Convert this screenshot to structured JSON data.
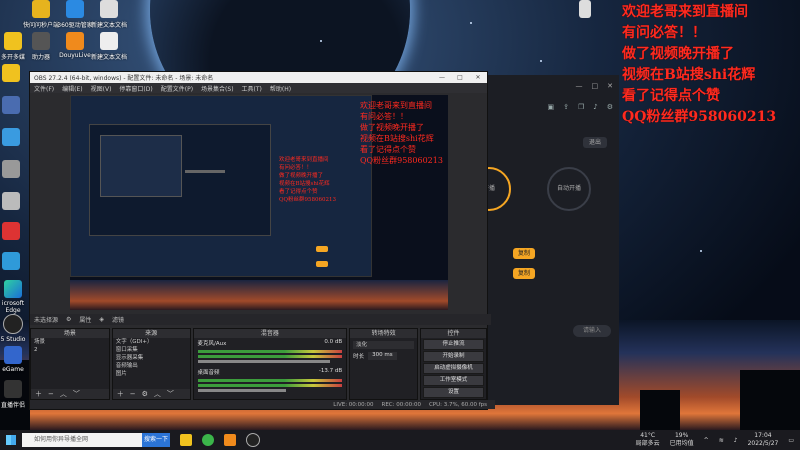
{
  "overlay": {
    "lines": [
      "欢迎老哥来到直播间",
      " 有问必答！！",
      "做了视频晚开播了",
      "视频在B站搜shi花辉",
      "看了记得点个赞",
      "QQ粉丝群958060213"
    ]
  },
  "desktop": {
    "icons": [
      {
        "label": "快问问秒户端",
        "icon": "qq-icon"
      },
      {
        "label": "360驱动管家",
        "icon": "driver-icon"
      },
      {
        "label": "新建文本文档",
        "icon": "text-file-icon"
      },
      {
        "label": "多开多媒",
        "icon": "app-icon"
      },
      {
        "label": "助力器",
        "icon": "app-icon"
      },
      {
        "label": "DouyuLive",
        "icon": "douyu-icon"
      },
      {
        "label": "新建文本文档",
        "icon": "text-file-icon"
      },
      {
        "label": "icrosoft Edge",
        "icon": "edge-icon"
      },
      {
        "label": "5 Studio",
        "icon": "obs-icon"
      },
      {
        "label": "eGame",
        "icon": "game-icon"
      },
      {
        "label": "直播伴侣",
        "icon": "stream-icon"
      }
    ]
  },
  "obs": {
    "title": "OBS 27.2.4 (64-bit, windows) - 配置文件: 未命名 - 场景: 未命名",
    "menu": [
      "文件(F)",
      "编辑(E)",
      "视图(V)",
      "停靠窗口(D)",
      "配置文件(P)",
      "场景集合(S)",
      "工具(T)",
      "帮助(H)"
    ],
    "status_bar": [
      "未选择源",
      "属性",
      "滤镜"
    ],
    "docks": {
      "scenes": {
        "title": "场景",
        "items": [
          "场景",
          "2"
        ]
      },
      "sources": {
        "title": "来源",
        "items": [
          "文字（GDI+）",
          "窗口采集",
          "显示器采集",
          "音频输出",
          "图片"
        ]
      },
      "mixer": {
        "title": "混音器",
        "channels": [
          {
            "name": "麦克风/Aux",
            "db": "0.0 dB"
          },
          {
            "name": "桌面音频",
            "db": "-13.7 dB"
          }
        ]
      },
      "transitions": {
        "title": "转场特效",
        "type": "淡化",
        "duration_label": "时长",
        "duration": "300 ms"
      },
      "controls": {
        "title": "控件",
        "buttons": [
          "停止推流",
          "开始录制",
          "启动虚拟摄像机",
          "工作室模式",
          "设置",
          "退出"
        ]
      }
    },
    "bottom_status": [
      "LIVE: 00:00:00",
      "REC: 00:00:00",
      "CPU: 3.7%, 60.00 fps"
    ]
  },
  "live_app": {
    "exit_label": "退出",
    "circles": [
      "开播",
      "自动开播"
    ],
    "buttons": [
      "复制",
      "复制"
    ],
    "bottom_input": "请输入"
  },
  "taskbar": {
    "search_placeholder": "如何用你异导播全网",
    "search_button": "搜索一下",
    "weather": "41°C",
    "weather_sub": "局部多云",
    "battery": "19%",
    "battery_sub": "已用均值",
    "time": "17:04",
    "date": "2022/5/27"
  }
}
